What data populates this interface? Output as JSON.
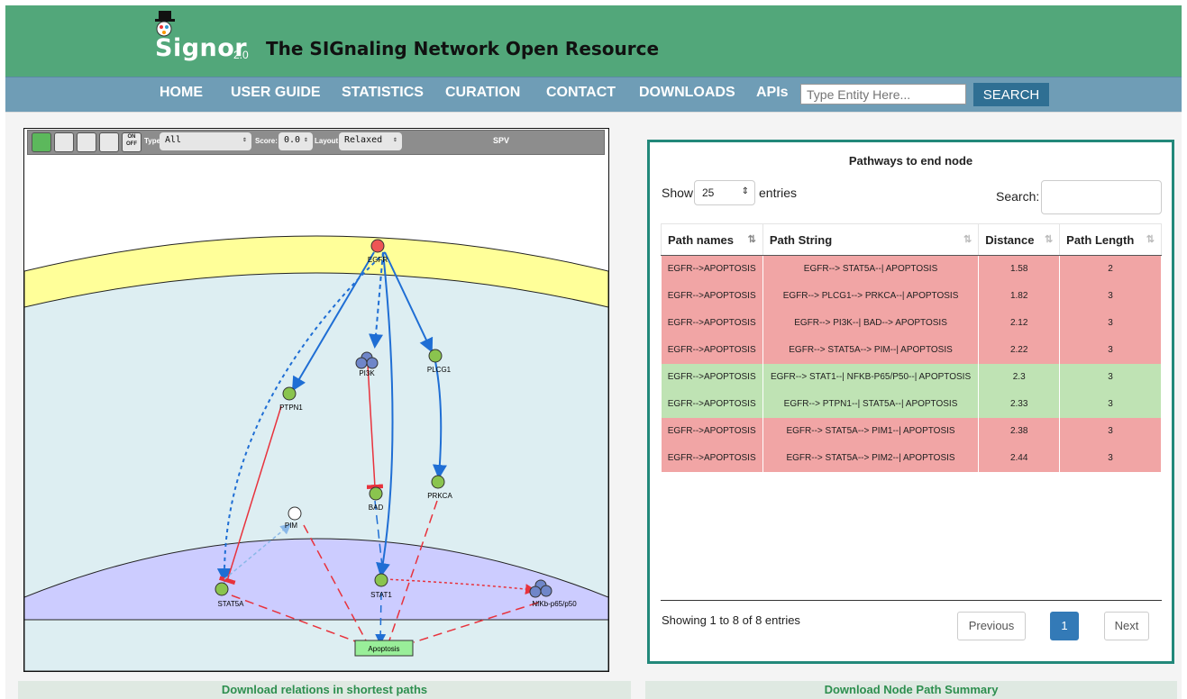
{
  "header": {
    "logo_main": "Signor",
    "logo_version": "2.0",
    "tagline": "The SIGnaling Network Open Resource"
  },
  "nav": {
    "items": [
      "HOME",
      "USER GUIDE",
      "STATISTICS",
      "CURATION",
      "CONTACT",
      "DOWNLOADS",
      "APIs"
    ],
    "search_placeholder": "Type Entity Here...",
    "search_button": "SEARCH"
  },
  "graph": {
    "toolbar": {
      "type_label": "Type:",
      "type_value": "All",
      "score_label": "Score:",
      "score_value": "0.0",
      "layout_label": "Layout:",
      "layout_value": "Relaxed",
      "onoff_label": "ON OFF",
      "spv_label": "SPV"
    },
    "nodes": {
      "egfr": "EGFR",
      "pi3k": "PI3K",
      "plcg1": "PLCG1",
      "ptpn1": "PTPN1",
      "bad": "BAD",
      "prkca": "PRKCA",
      "pim": "PIM",
      "stat5a": "STAT5A",
      "stat1": "STAT1",
      "nfkb": "NfKb-p65/p50",
      "apoptosis": "Apoptosis"
    },
    "colors": {
      "membrane": "#ffff99",
      "cytoplasm": "#ddeef2",
      "nucleus": "#ccccff",
      "activation": "#1f6ed4",
      "inhibition": "#e8323c",
      "protein": "#8ac44e",
      "complex": "#6f86c9"
    }
  },
  "downloads": {
    "left": "Download relations in shortest paths",
    "right": "Download Node Path Summary"
  },
  "panel": {
    "title": "Pathways to end node",
    "show_label": "Show",
    "show_value": "25",
    "entries_label": "entries",
    "search_label": "Search:",
    "columns": [
      "Path names",
      "Path String",
      "Distance",
      "Path Length"
    ],
    "rows": [
      {
        "name": "EGFR-->APOPTOSIS",
        "path": "EGFR--> STAT5A--| APOPTOSIS",
        "distance": "1.58",
        "length": "2",
        "status": "red"
      },
      {
        "name": "EGFR-->APOPTOSIS",
        "path": "EGFR--> PLCG1--> PRKCA--| APOPTOSIS",
        "distance": "1.82",
        "length": "3",
        "status": "red"
      },
      {
        "name": "EGFR-->APOPTOSIS",
        "path": "EGFR--> PI3K--| BAD--> APOPTOSIS",
        "distance": "2.12",
        "length": "3",
        "status": "red"
      },
      {
        "name": "EGFR-->APOPTOSIS",
        "path": "EGFR--> STAT5A--> PIM--| APOPTOSIS",
        "distance": "2.22",
        "length": "3",
        "status": "red"
      },
      {
        "name": "EGFR-->APOPTOSIS",
        "path": "EGFR--> STAT1--| NFKB-P65/P50--| APOPTOSIS",
        "distance": "2.3",
        "length": "3",
        "status": "green"
      },
      {
        "name": "EGFR-->APOPTOSIS",
        "path": "EGFR--> PTPN1--| STAT5A--| APOPTOSIS",
        "distance": "2.33",
        "length": "3",
        "status": "green"
      },
      {
        "name": "EGFR-->APOPTOSIS",
        "path": "EGFR--> STAT5A--> PIM1--| APOPTOSIS",
        "distance": "2.38",
        "length": "3",
        "status": "red"
      },
      {
        "name": "EGFR-->APOPTOSIS",
        "path": "EGFR--> STAT5A--> PIM2--| APOPTOSIS",
        "distance": "2.44",
        "length": "3",
        "status": "red"
      }
    ],
    "showing": "Showing 1 to 8 of 8 entries",
    "pagination": {
      "previous": "Previous",
      "current": "1",
      "next": "Next"
    }
  }
}
